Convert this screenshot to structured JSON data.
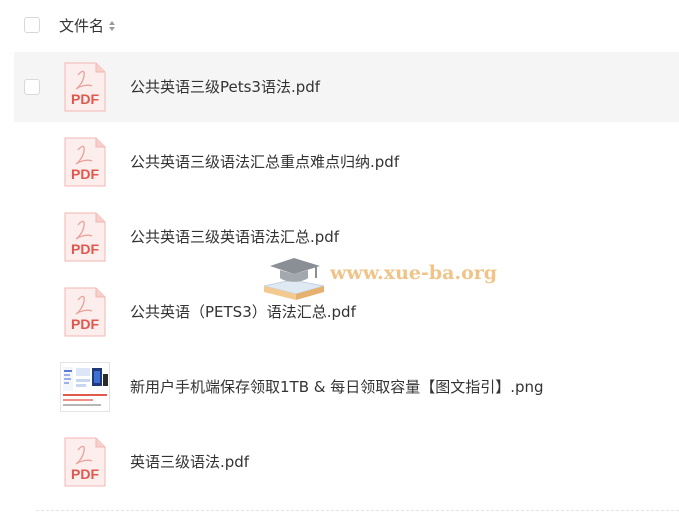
{
  "header": {
    "column_label": "文件名",
    "sort_icon": "sort-icon"
  },
  "files": [
    {
      "name": "公共英语三级Pets3语法.pdf",
      "type": "pdf",
      "icon_text": "PDF"
    },
    {
      "name": "公共英语三级语法汇总重点难点归纳.pdf",
      "type": "pdf",
      "icon_text": "PDF"
    },
    {
      "name": "公共英语三级英语语法汇总.pdf",
      "type": "pdf",
      "icon_text": "PDF"
    },
    {
      "name": "公共英语（PETS3）语法汇总.pdf",
      "type": "pdf",
      "icon_text": "PDF"
    },
    {
      "name": "新用户手机端保存领取1TB & 每日领取容量【图文指引】.png",
      "type": "png",
      "icon_text": ""
    },
    {
      "name": "英语三级语法.pdf",
      "type": "pdf",
      "icon_text": "PDF"
    }
  ],
  "watermark": {
    "text": "www.xue-ba.org"
  },
  "colors": {
    "pdf_red": "#e2574c",
    "pdf_bg": "#fdeeee",
    "watermark": "#f0c489",
    "hover_row": "#f5f5f6"
  }
}
